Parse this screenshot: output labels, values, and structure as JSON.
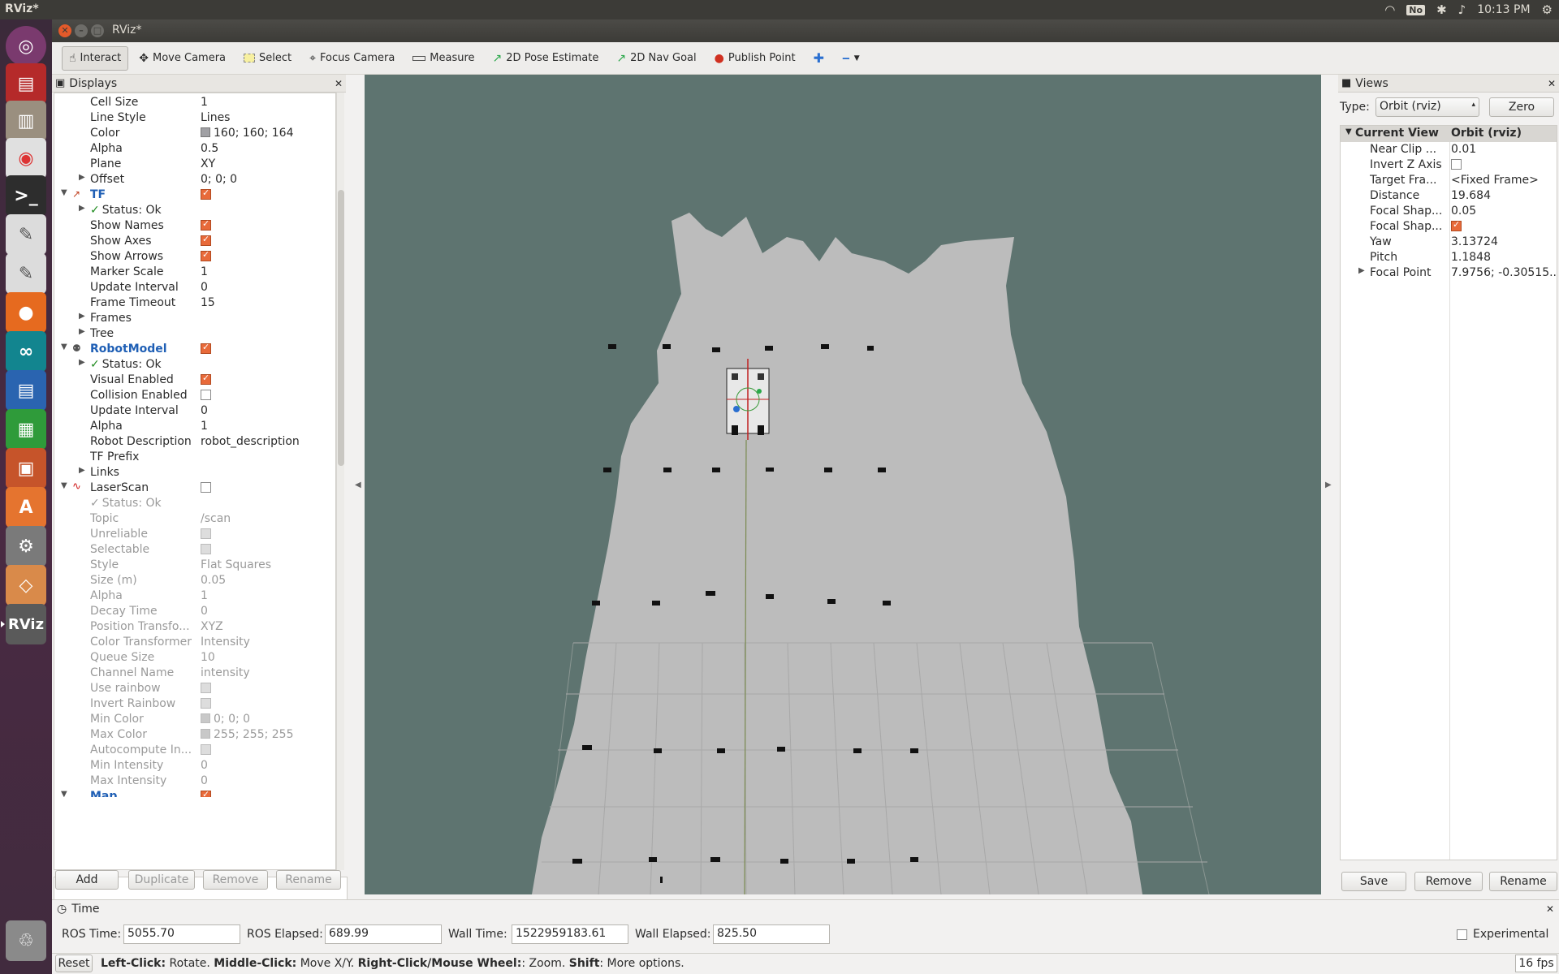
{
  "system": {
    "app_title": "RViz*",
    "tray_no": "No",
    "clock": "10:13 PM"
  },
  "window": {
    "title": "RViz*"
  },
  "toolbar": {
    "tools": [
      {
        "label": "Interact",
        "icon": "hand-icon"
      },
      {
        "label": "Move Camera",
        "icon": "move-camera-icon"
      },
      {
        "label": "Select",
        "icon": "select-icon"
      },
      {
        "label": "Focus Camera",
        "icon": "focus-icon"
      },
      {
        "label": "Measure",
        "icon": "ruler-icon"
      },
      {
        "label": "2D Pose Estimate",
        "icon": "pose-arrow-icon"
      },
      {
        "label": "2D Nav Goal",
        "icon": "goal-arrow-icon"
      },
      {
        "label": "Publish Point",
        "icon": "pin-icon"
      }
    ]
  },
  "displays": {
    "title": "Displays",
    "rows": [
      {
        "label": "Cell Size",
        "value": "1"
      },
      {
        "label": "Line Style",
        "value": "Lines"
      },
      {
        "label": "Color",
        "value": "160; 160; 164"
      },
      {
        "label": "Alpha",
        "value": "0.5"
      },
      {
        "label": "Plane",
        "value": "XY"
      },
      {
        "label": "Offset",
        "value": "0; 0; 0"
      },
      {
        "label": "TF",
        "value": ""
      },
      {
        "label": "Status: Ok",
        "value": ""
      },
      {
        "label": "Show Names",
        "value": ""
      },
      {
        "label": "Show Axes",
        "value": ""
      },
      {
        "label": "Show Arrows",
        "value": ""
      },
      {
        "label": "Marker Scale",
        "value": "1"
      },
      {
        "label": "Update Interval",
        "value": "0"
      },
      {
        "label": "Frame Timeout",
        "value": "15"
      },
      {
        "label": "Frames",
        "value": ""
      },
      {
        "label": "Tree",
        "value": ""
      },
      {
        "label": "RobotModel",
        "value": ""
      },
      {
        "label": "Status: Ok",
        "value": ""
      },
      {
        "label": "Visual Enabled",
        "value": ""
      },
      {
        "label": "Collision Enabled",
        "value": ""
      },
      {
        "label": "Update Interval",
        "value": "0"
      },
      {
        "label": "Alpha",
        "value": "1"
      },
      {
        "label": "Robot Description",
        "value": "robot_description"
      },
      {
        "label": "TF Prefix",
        "value": ""
      },
      {
        "label": "Links",
        "value": ""
      },
      {
        "label": "LaserScan",
        "value": ""
      },
      {
        "label": "Status: Ok",
        "value": ""
      },
      {
        "label": "Topic",
        "value": "/scan"
      },
      {
        "label": "Unreliable",
        "value": ""
      },
      {
        "label": "Selectable",
        "value": ""
      },
      {
        "label": "Style",
        "value": "Flat Squares"
      },
      {
        "label": "Size (m)",
        "value": "0.05"
      },
      {
        "label": "Alpha",
        "value": "1"
      },
      {
        "label": "Decay Time",
        "value": "0"
      },
      {
        "label": "Position Transfo...",
        "value": "XYZ"
      },
      {
        "label": "Color Transformer",
        "value": "Intensity"
      },
      {
        "label": "Queue Size",
        "value": "10"
      },
      {
        "label": "Channel Name",
        "value": "intensity"
      },
      {
        "label": "Use rainbow",
        "value": ""
      },
      {
        "label": "Invert Rainbow",
        "value": ""
      },
      {
        "label": "Min Color",
        "value": "0; 0; 0"
      },
      {
        "label": "Max Color",
        "value": "255; 255; 255"
      },
      {
        "label": "Autocompute In...",
        "value": ""
      },
      {
        "label": "Min Intensity",
        "value": "0"
      },
      {
        "label": "Max Intensity",
        "value": "0"
      },
      {
        "label": "Map",
        "value": ""
      }
    ],
    "buttons": {
      "add": "Add",
      "duplicate": "Duplicate",
      "remove": "Remove",
      "rename": "Rename"
    }
  },
  "views": {
    "title": "Views",
    "type_label": "Type:",
    "type_value": "Orbit (rviz)",
    "zero": "Zero",
    "header_name": "Current View",
    "header_value": "Orbit (rviz)",
    "rows": [
      {
        "label": "Near Clip ...",
        "value": "0.01"
      },
      {
        "label": "Invert Z Axis",
        "value": ""
      },
      {
        "label": "Target Fra...",
        "value": "<Fixed Frame>"
      },
      {
        "label": "Distance",
        "value": "19.684"
      },
      {
        "label": "Focal Shap...",
        "value": "0.05"
      },
      {
        "label": "Focal Shap...",
        "value": ""
      },
      {
        "label": "Yaw",
        "value": "3.13724"
      },
      {
        "label": "Pitch",
        "value": "1.1848"
      },
      {
        "label": "Focal Point",
        "value": "7.9756; -0.30515..."
      }
    ],
    "buttons": {
      "save": "Save",
      "remove": "Remove",
      "rename": "Rename"
    }
  },
  "time": {
    "title": "Time",
    "ros_time_label": "ROS Time:",
    "ros_time": "5055.70",
    "ros_elapsed_label": "ROS Elapsed:",
    "ros_elapsed": "689.99",
    "wall_time_label": "Wall Time:",
    "wall_time": "1522959183.61",
    "wall_elapsed_label": "Wall Elapsed:",
    "wall_elapsed": "825.50",
    "experimental": "Experimental"
  },
  "status": {
    "reset": "Reset",
    "k1": "Left-Click:",
    "t1": " Rotate. ",
    "k2": "Middle-Click:",
    "t2": " Move X/Y. ",
    "k3": "Right-Click/Mouse Wheel:",
    "t3": ": Zoom. ",
    "k4": "Shift",
    "t4": ": More options.",
    "fps": "16 fps"
  },
  "colors": {
    "viewport_bg": "#5e7470",
    "map_free": "#bcbcbc",
    "obstacle": "#111111",
    "accent_checkbox": "#e86a3a"
  }
}
